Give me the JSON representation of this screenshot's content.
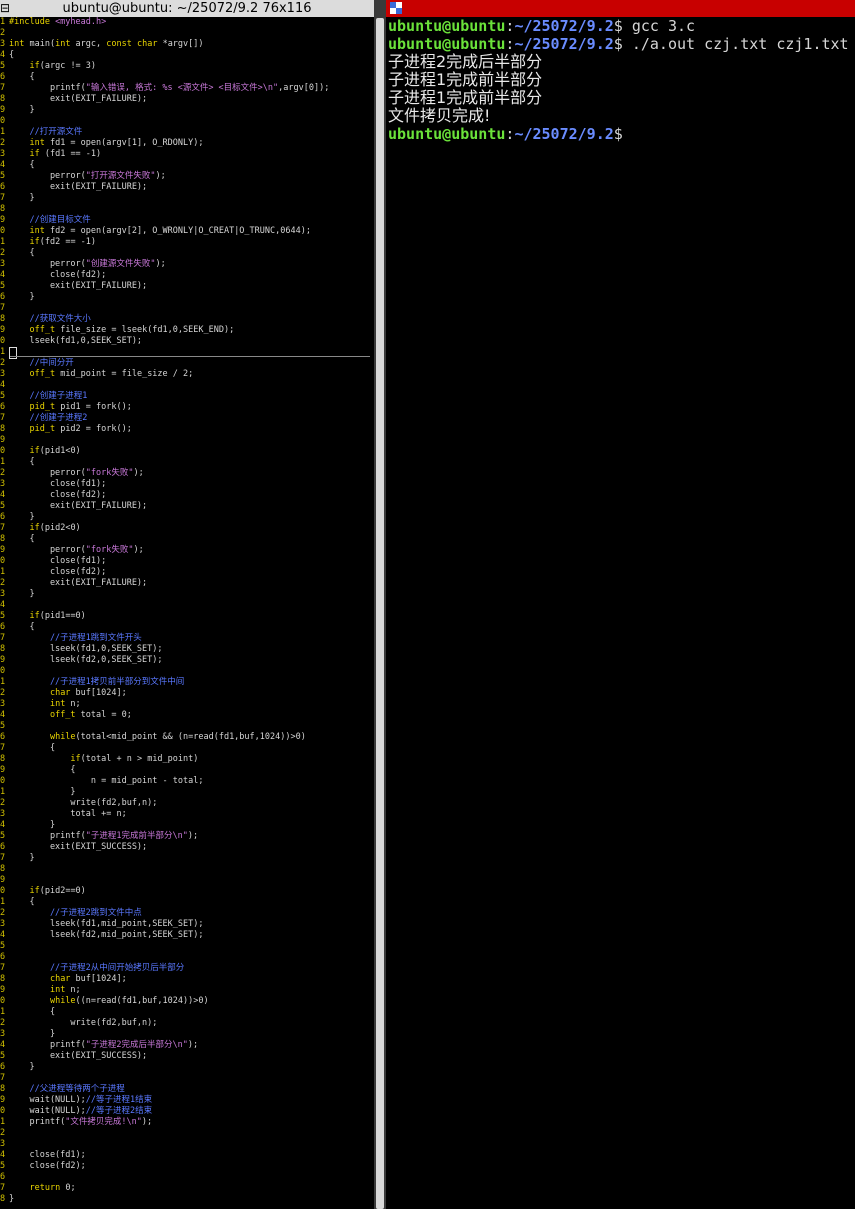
{
  "left_window": {
    "title": "ubuntu@ubuntu: ~/25072/9.2 76x116",
    "icon": "window-menu-icon"
  },
  "code_lines": [
    {
      "n": "1",
      "segs": [
        [
          "#include ",
          "kw"
        ],
        [
          "<myhead.h>",
          "st"
        ]
      ]
    },
    {
      "n": "2",
      "segs": []
    },
    {
      "n": "3",
      "segs": [
        [
          "int",
          "kw"
        ],
        [
          " main(",
          "code"
        ],
        [
          "int",
          "kw"
        ],
        [
          " argc, ",
          "code"
        ],
        [
          "const char",
          "kw"
        ],
        [
          " *argv[])",
          "code"
        ]
      ]
    },
    {
      "n": "4",
      "segs": [
        [
          "{",
          "code"
        ]
      ]
    },
    {
      "n": "5",
      "segs": [
        [
          "    ",
          "code"
        ],
        [
          "if",
          "kw"
        ],
        [
          "(argc != 3)",
          "code"
        ]
      ]
    },
    {
      "n": "6",
      "segs": [
        [
          "    {",
          "code"
        ]
      ]
    },
    {
      "n": "7",
      "segs": [
        [
          "        printf(",
          "code"
        ],
        [
          "\"输入错误, 格式: %s <源文件> <目标文件>\\n\"",
          "st"
        ],
        [
          ",argv[0]);",
          "code"
        ]
      ]
    },
    {
      "n": "8",
      "segs": [
        [
          "        exit(EXIT_FAILURE);",
          "code"
        ]
      ]
    },
    {
      "n": "9",
      "segs": [
        [
          "    }",
          "code"
        ]
      ]
    },
    {
      "n": "0",
      "segs": []
    },
    {
      "n": "1",
      "segs": [
        [
          "    //打开源文件",
          "cm"
        ]
      ]
    },
    {
      "n": "2",
      "segs": [
        [
          "    ",
          "code"
        ],
        [
          "int",
          "kw"
        ],
        [
          " fd1 = open(argv[1], O_RDONLY);",
          "code"
        ]
      ]
    },
    {
      "n": "3",
      "segs": [
        [
          "    ",
          "code"
        ],
        [
          "if",
          "kw"
        ],
        [
          " (fd1 == -1)",
          "code"
        ]
      ]
    },
    {
      "n": "4",
      "segs": [
        [
          "    {",
          "code"
        ]
      ]
    },
    {
      "n": "5",
      "segs": [
        [
          "        perror(",
          "code"
        ],
        [
          "\"打开源文件失败\"",
          "st"
        ],
        [
          ");",
          "code"
        ]
      ]
    },
    {
      "n": "6",
      "segs": [
        [
          "        exit(EXIT_FAILURE);",
          "code"
        ]
      ]
    },
    {
      "n": "7",
      "segs": [
        [
          "    }",
          "code"
        ]
      ]
    },
    {
      "n": "8",
      "segs": []
    },
    {
      "n": "9",
      "segs": [
        [
          "    //创建目标文件",
          "cm"
        ]
      ]
    },
    {
      "n": "0",
      "segs": [
        [
          "    ",
          "code"
        ],
        [
          "int",
          "kw"
        ],
        [
          " fd2 = open(argv[2], O_WRONLY|O_CREAT|O_TRUNC,0644);",
          "code"
        ]
      ]
    },
    {
      "n": "1",
      "segs": [
        [
          "    ",
          "code"
        ],
        [
          "if",
          "kw"
        ],
        [
          "(fd2 == -1)",
          "code"
        ]
      ]
    },
    {
      "n": "2",
      "segs": [
        [
          "    {",
          "code"
        ]
      ]
    },
    {
      "n": "3",
      "segs": [
        [
          "        perror(",
          "code"
        ],
        [
          "\"创建源文件失败\"",
          "st"
        ],
        [
          ");",
          "code"
        ]
      ]
    },
    {
      "n": "4",
      "segs": [
        [
          "        close(fd2);",
          "code"
        ]
      ]
    },
    {
      "n": "5",
      "segs": [
        [
          "        exit(EXIT_FAILURE);",
          "code"
        ]
      ]
    },
    {
      "n": "6",
      "segs": [
        [
          "    }",
          "code"
        ]
      ]
    },
    {
      "n": "7",
      "segs": []
    },
    {
      "n": "8",
      "segs": [
        [
          "    //获取文件大小",
          "cm"
        ]
      ]
    },
    {
      "n": "9",
      "segs": [
        [
          "    ",
          "code"
        ],
        [
          "off_t",
          "kw"
        ],
        [
          " file_size = lseek(fd1,0,SEEK_END);",
          "code"
        ]
      ]
    },
    {
      "n": "0",
      "segs": [
        [
          "    lseek(fd1,0,SEEK_SET);",
          "code"
        ]
      ]
    },
    {
      "n": "1",
      "segs": [
        [
          "CURSOR",
          "cursor"
        ]
      ]
    },
    {
      "n": "2",
      "segs": [
        [
          "    //中间分开",
          "cm"
        ]
      ]
    },
    {
      "n": "3",
      "segs": [
        [
          "    ",
          "code"
        ],
        [
          "off_t",
          "kw"
        ],
        [
          " mid_point = file_size / 2;",
          "code"
        ]
      ]
    },
    {
      "n": "4",
      "segs": []
    },
    {
      "n": "5",
      "segs": [
        [
          "    //创建子进程1",
          "cm"
        ]
      ]
    },
    {
      "n": "6",
      "segs": [
        [
          "    ",
          "code"
        ],
        [
          "pid_t",
          "kw"
        ],
        [
          " pid1 = fork();",
          "code"
        ]
      ]
    },
    {
      "n": "7",
      "segs": [
        [
          "    //创建子进程2",
          "cm"
        ]
      ]
    },
    {
      "n": "8",
      "segs": [
        [
          "    ",
          "code"
        ],
        [
          "pid_t",
          "kw"
        ],
        [
          " pid2 = fork();",
          "code"
        ]
      ]
    },
    {
      "n": "9",
      "segs": []
    },
    {
      "n": "0",
      "segs": [
        [
          "    ",
          "code"
        ],
        [
          "if",
          "kw"
        ],
        [
          "(pid1<0)",
          "code"
        ]
      ]
    },
    {
      "n": "1",
      "segs": [
        [
          "    {",
          "code"
        ]
      ]
    },
    {
      "n": "2",
      "segs": [
        [
          "        perror(",
          "code"
        ],
        [
          "\"fork失败\"",
          "st"
        ],
        [
          ");",
          "code"
        ]
      ]
    },
    {
      "n": "3",
      "segs": [
        [
          "        close(fd1);",
          "code"
        ]
      ]
    },
    {
      "n": "4",
      "segs": [
        [
          "        close(fd2);",
          "code"
        ]
      ]
    },
    {
      "n": "5",
      "segs": [
        [
          "        exit(EXIT_FAILURE);",
          "code"
        ]
      ]
    },
    {
      "n": "6",
      "segs": [
        [
          "    }",
          "code"
        ]
      ]
    },
    {
      "n": "7",
      "segs": [
        [
          "    ",
          "code"
        ],
        [
          "if",
          "kw"
        ],
        [
          "(pid2<0)",
          "code"
        ]
      ]
    },
    {
      "n": "8",
      "segs": [
        [
          "    {",
          "code"
        ]
      ]
    },
    {
      "n": "9",
      "segs": [
        [
          "        perror(",
          "code"
        ],
        [
          "\"fork失败\"",
          "st"
        ],
        [
          ");",
          "code"
        ]
      ]
    },
    {
      "n": "0",
      "segs": [
        [
          "        close(fd1);",
          "code"
        ]
      ]
    },
    {
      "n": "1",
      "segs": [
        [
          "        close(fd2);",
          "code"
        ]
      ]
    },
    {
      "n": "2",
      "segs": [
        [
          "        exit(EXIT_FAILURE);",
          "code"
        ]
      ]
    },
    {
      "n": "3",
      "segs": [
        [
          "    }",
          "code"
        ]
      ]
    },
    {
      "n": "4",
      "segs": []
    },
    {
      "n": "5",
      "segs": [
        [
          "    ",
          "code"
        ],
        [
          "if",
          "kw"
        ],
        [
          "(pid1==0)",
          "code"
        ]
      ]
    },
    {
      "n": "6",
      "segs": [
        [
          "    {",
          "code"
        ]
      ]
    },
    {
      "n": "7",
      "segs": [
        [
          "        //子进程1跳到文件开头",
          "cm"
        ]
      ]
    },
    {
      "n": "8",
      "segs": [
        [
          "        lseek(fd1,0,SEEK_SET);",
          "code"
        ]
      ]
    },
    {
      "n": "9",
      "segs": [
        [
          "        lseek(fd2,0,SEEK_SET);",
          "code"
        ]
      ]
    },
    {
      "n": "0",
      "segs": []
    },
    {
      "n": "1",
      "segs": [
        [
          "        //子进程1拷贝前半部分到文件中间",
          "cm"
        ]
      ]
    },
    {
      "n": "2",
      "segs": [
        [
          "        ",
          "code"
        ],
        [
          "char",
          "kw"
        ],
        [
          " buf[1024];",
          "code"
        ]
      ]
    },
    {
      "n": "3",
      "segs": [
        [
          "        ",
          "code"
        ],
        [
          "int",
          "kw"
        ],
        [
          " n;",
          "code"
        ]
      ]
    },
    {
      "n": "4",
      "segs": [
        [
          "        ",
          "code"
        ],
        [
          "off_t",
          "kw"
        ],
        [
          " total = 0;",
          "code"
        ]
      ]
    },
    {
      "n": "5",
      "segs": []
    },
    {
      "n": "6",
      "segs": [
        [
          "        ",
          "code"
        ],
        [
          "while",
          "kw"
        ],
        [
          "(total<mid_point && (n=read(fd1,buf,1024))>0)",
          "code"
        ]
      ]
    },
    {
      "n": "7",
      "segs": [
        [
          "        {",
          "code"
        ]
      ]
    },
    {
      "n": "8",
      "segs": [
        [
          "            ",
          "code"
        ],
        [
          "if",
          "kw"
        ],
        [
          "(total + n > mid_point)",
          "code"
        ]
      ]
    },
    {
      "n": "9",
      "segs": [
        [
          "            {",
          "code"
        ]
      ]
    },
    {
      "n": "0",
      "segs": [
        [
          "                n = mid_point - total;",
          "code"
        ]
      ]
    },
    {
      "n": "1",
      "segs": [
        [
          "            }",
          "code"
        ]
      ]
    },
    {
      "n": "2",
      "segs": [
        [
          "            write(fd2,buf,n);",
          "code"
        ]
      ]
    },
    {
      "n": "3",
      "segs": [
        [
          "            total += n;",
          "code"
        ]
      ]
    },
    {
      "n": "4",
      "segs": [
        [
          "        }",
          "code"
        ]
      ]
    },
    {
      "n": "5",
      "segs": [
        [
          "        printf(",
          "code"
        ],
        [
          "\"子进程1完成前半部分\\n\"",
          "st"
        ],
        [
          ");",
          "code"
        ]
      ]
    },
    {
      "n": "6",
      "segs": [
        [
          "        exit(EXIT_SUCCESS);",
          "code"
        ]
      ]
    },
    {
      "n": "7",
      "segs": [
        [
          "    }",
          "code"
        ]
      ]
    },
    {
      "n": "8",
      "segs": []
    },
    {
      "n": "9",
      "segs": []
    },
    {
      "n": "0",
      "segs": [
        [
          "    ",
          "code"
        ],
        [
          "if",
          "kw"
        ],
        [
          "(pid2==0)",
          "code"
        ]
      ]
    },
    {
      "n": "1",
      "segs": [
        [
          "    {",
          "code"
        ]
      ]
    },
    {
      "n": "2",
      "segs": [
        [
          "        //子进程2跳到文件中点",
          "cm"
        ]
      ]
    },
    {
      "n": "3",
      "segs": [
        [
          "        lseek(fd1,mid_point,SEEK_SET);",
          "code"
        ]
      ]
    },
    {
      "n": "4",
      "segs": [
        [
          "        lseek(fd2,mid_point,SEEK_SET);",
          "code"
        ]
      ]
    },
    {
      "n": "5",
      "segs": []
    },
    {
      "n": "6",
      "segs": []
    },
    {
      "n": "7",
      "segs": [
        [
          "        //子进程2从中间开始拷贝后半部分",
          "cm"
        ]
      ]
    },
    {
      "n": "8",
      "segs": [
        [
          "        ",
          "code"
        ],
        [
          "char",
          "kw"
        ],
        [
          " buf[1024];",
          "code"
        ]
      ]
    },
    {
      "n": "9",
      "segs": [
        [
          "        ",
          "code"
        ],
        [
          "int",
          "kw"
        ],
        [
          " n;",
          "code"
        ]
      ]
    },
    {
      "n": "0",
      "segs": [
        [
          "        ",
          "code"
        ],
        [
          "while",
          "kw"
        ],
        [
          "((n=read(fd1,buf,1024))>0)",
          "code"
        ]
      ]
    },
    {
      "n": "1",
      "segs": [
        [
          "        {",
          "code"
        ]
      ]
    },
    {
      "n": "2",
      "segs": [
        [
          "            write(fd2,buf,n);",
          "code"
        ]
      ]
    },
    {
      "n": "3",
      "segs": [
        [
          "        }",
          "code"
        ]
      ]
    },
    {
      "n": "4",
      "segs": [
        [
          "        printf(",
          "code"
        ],
        [
          "\"子进程2完成后半部分\\n\"",
          "st"
        ],
        [
          ");",
          "code"
        ]
      ]
    },
    {
      "n": "5",
      "segs": [
        [
          "        exit(EXIT_SUCCESS);",
          "code"
        ]
      ]
    },
    {
      "n": "6",
      "segs": [
        [
          "    }",
          "code"
        ]
      ]
    },
    {
      "n": "7",
      "segs": []
    },
    {
      "n": "8",
      "segs": [
        [
          "    //父进程等待两个子进程",
          "cm"
        ]
      ]
    },
    {
      "n": "9",
      "segs": [
        [
          "    wait(NULL);",
          "code"
        ],
        [
          "//等子进程1结束",
          "cm"
        ]
      ]
    },
    {
      "n": "0",
      "segs": [
        [
          "    wait(NULL);",
          "code"
        ],
        [
          "//等子进程2结束",
          "cm"
        ]
      ]
    },
    {
      "n": "1",
      "segs": [
        [
          "    printf(",
          "code"
        ],
        [
          "\"文件拷贝完成!\\n\"",
          "st"
        ],
        [
          ");",
          "code"
        ]
      ]
    },
    {
      "n": "2",
      "segs": []
    },
    {
      "n": "3",
      "segs": []
    },
    {
      "n": "4",
      "segs": [
        [
          "    close(fd1);",
          "code"
        ]
      ]
    },
    {
      "n": "5",
      "segs": [
        [
          "    close(fd2);",
          "code"
        ]
      ]
    },
    {
      "n": "6",
      "segs": []
    },
    {
      "n": "7",
      "segs": [
        [
          "    ",
          "code"
        ],
        [
          "return",
          "kw"
        ],
        [
          " 0;",
          "code"
        ]
      ]
    },
    {
      "n": "8",
      "segs": [
        [
          "}",
          "code"
        ]
      ]
    }
  ],
  "right_terminal": {
    "icon": "terminal-app-icon",
    "lines": [
      {
        "user": "ubuntu@ubuntu",
        "sep": ":",
        "path": "~/25072/9.2",
        "sym": "$",
        "cmd": " gcc 3.c"
      },
      {
        "user": "ubuntu@ubuntu",
        "sep": ":",
        "path": "~/25072/9.2",
        "sym": "$",
        "cmd": " ./a.out czj.txt czj1.txt"
      },
      {
        "output": "子进程2完成后半部分"
      },
      {
        "output": "子进程1完成前半部分"
      },
      {
        "output": "子进程1完成前半部分"
      },
      {
        "output": "文件拷贝完成!"
      },
      {
        "user": "ubuntu@ubuntu",
        "sep": ":",
        "path": "~/25072/9.2",
        "sym": "$",
        "cmd": ""
      }
    ]
  },
  "colors": {
    "left_title_bg": "#dcdcdc",
    "right_title_bg": "#c80000",
    "prompt_user": "#6be23a",
    "prompt_path": "#6a8cff",
    "keyword": "#e8d400",
    "comment": "#5a78ff",
    "string": "#c878d8"
  }
}
